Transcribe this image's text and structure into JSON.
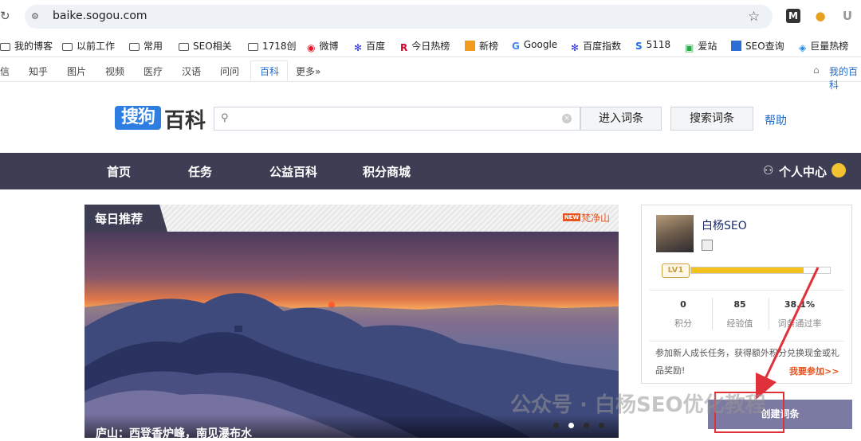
{
  "browser": {
    "url": "baike.sogou.com",
    "extensions": [
      {
        "name": "m-extension-icon",
        "label": "M",
        "color": "#333333"
      },
      {
        "name": "sogou-extension-icon",
        "label": "",
        "color": "#e8a020"
      },
      {
        "name": "u-extension-icon",
        "label": "U",
        "color": "#999999"
      }
    ],
    "bookmarks": [
      {
        "label": "我的博客",
        "icon": "folder"
      },
      {
        "label": "以前工作",
        "icon": "folder"
      },
      {
        "label": "常用",
        "icon": "folder"
      },
      {
        "label": "SEO相关",
        "icon": "folder"
      },
      {
        "label": "1718创",
        "icon": "folder"
      },
      {
        "label": "微博",
        "icon": "weibo"
      },
      {
        "label": "百度",
        "icon": "baidu"
      },
      {
        "label": "今日热榜",
        "icon": "r"
      },
      {
        "label": "新榜",
        "icon": "xinbang"
      },
      {
        "label": "Google",
        "icon": "google"
      },
      {
        "label": "百度指数",
        "icon": "baidu"
      },
      {
        "label": "5118",
        "icon": "5118"
      },
      {
        "label": "爱站",
        "icon": "aizhan"
      },
      {
        "label": "SEO查询",
        "icon": "seo"
      },
      {
        "label": "巨量热榜",
        "icon": "juliang"
      }
    ]
  },
  "topnav": {
    "items": [
      "信",
      "知乎",
      "图片",
      "视频",
      "医疗",
      "汉语",
      "问问",
      "百科",
      "更多»"
    ],
    "active": "百科",
    "right_label": "我的百科"
  },
  "header": {
    "logo_box": "搜狗",
    "logo_text": "百科",
    "search_value": "",
    "enter_button": "进入词条",
    "search_button": "搜索词条",
    "help": "帮助"
  },
  "menu": {
    "items": [
      "首页",
      "任务",
      "公益百科",
      "积分商城"
    ],
    "user_center": "个人中心"
  },
  "daily": {
    "title": "每日推荐",
    "new_tag": "NEW",
    "topic": "梵净山",
    "caption": "庐山：西登香炉峰，南见瀑布水",
    "slides": 4,
    "active_slide": 1
  },
  "user": {
    "name": "白杨SEO",
    "level": "LV1",
    "progress": 0.81,
    "stats": [
      {
        "value": "0",
        "label": "积分"
      },
      {
        "value": "85",
        "label": "经验值"
      },
      {
        "value": "38.1%",
        "label": "词条通过率"
      }
    ],
    "promo": "参加新人成长任务，获得额外积分兑换现金或礼品奖励!",
    "join": "我要参加>>",
    "create": "创建词条"
  },
  "watermark": "公众号 · 白杨SEO优化教程",
  "colors": {
    "menu_bg": "#3d3d54",
    "link": "#1a6bd0",
    "accent": "#e8541d",
    "highlight": "#e0303a",
    "create_bg": "#7b7aa3"
  }
}
